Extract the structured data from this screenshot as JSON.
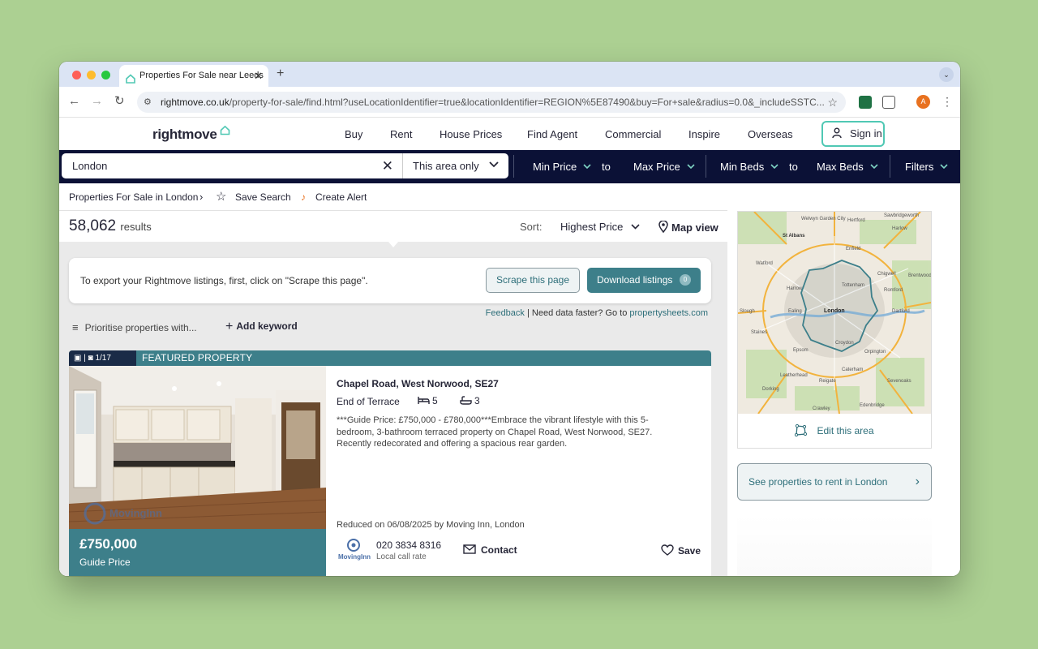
{
  "browser": {
    "tab_title": "Properties For Sale near Leeds",
    "url_main": "rightmove.co.uk",
    "url_rest": "/property-for-sale/find.html?useLocationIdentifier=true&locationIdentifier=REGION%5E87490&buy=For+sale&radius=0.0&_includeSSTC...",
    "avatar_letter": "A"
  },
  "header": {
    "logo": "rightmove",
    "nav": [
      "Buy",
      "Rent",
      "House Prices",
      "Find Agent",
      "Commercial",
      "Inspire",
      "Overseas"
    ],
    "sign_in": "Sign in"
  },
  "search": {
    "location": "London",
    "area": "This area only",
    "min_price": "Min Price",
    "to1": "to",
    "max_price": "Max Price",
    "min_beds": "Min Beds",
    "to2": "to",
    "max_beds": "Max Beds",
    "filters": "Filters"
  },
  "breadcrumb": {
    "crumb": "Properties For Sale in London",
    "save_search": "Save Search",
    "create_alert": "Create Alert"
  },
  "results": {
    "count": "58,062",
    "label": "results",
    "sort_label": "Sort:",
    "sort_value": "Highest Price",
    "map_view": "Map view"
  },
  "scraper": {
    "text": "To export your Rightmove listings, first, click on \"Scrape this page\".",
    "scrape_btn": "Scrape this page",
    "download_btn": "Download listings",
    "download_count": "0",
    "feedback": "Feedback",
    "need_data": "Need data faster? Go to",
    "link": "propertysheets.com",
    "prioritise": "Prioritise properties with...",
    "add_keyword": "Add keyword"
  },
  "listing": {
    "photo_count": "1/17",
    "featured": "FEATURED PROPERTY",
    "watermark": "MovingInn",
    "price": "£750,000",
    "price_qualifier": "Guide Price",
    "address": "Chapel Road, West Norwood, SE27",
    "type": "End of Terrace",
    "bedrooms": "5",
    "bathrooms": "3",
    "description": "***Guide Price: £750,000 - £780,000***Embrace the vibrant lifestyle with this 5-bedroom, 3-bathroom terraced property on Chapel Road, West Norwood, SE27. Recently redecorated and offering a spacious rear garden.",
    "reduced": "Reduced on 06/08/2025 by Moving Inn, London",
    "agent_logo_text": "MovingInn",
    "phone": "020 3834 8316",
    "local_rate": "Local call rate",
    "contact": "Contact",
    "save": "Save"
  },
  "map": {
    "labels": [
      "Welwyn Garden City",
      "St Albans",
      "Hertford",
      "Sawbridgeworth",
      "Harlow",
      "Enfield",
      "Watford",
      "Chigwell",
      "Harrow",
      "Tottenham",
      "Romford",
      "Brentwood",
      "Slough",
      "Ealing",
      "London",
      "Dartford",
      "Staines",
      "Croydon",
      "Orpington",
      "Epsom",
      "Leatherhead",
      "Reigate",
      "Caterham",
      "Sevenoaks",
      "Dorking",
      "Edenbridge",
      "Crawley"
    ],
    "edit_area": "Edit this area",
    "rent_link": "See properties to rent in London"
  },
  "colors": {
    "brand_teal": "#3d7f8a",
    "navy": "#0b1136",
    "mint": "#50c8b4"
  }
}
